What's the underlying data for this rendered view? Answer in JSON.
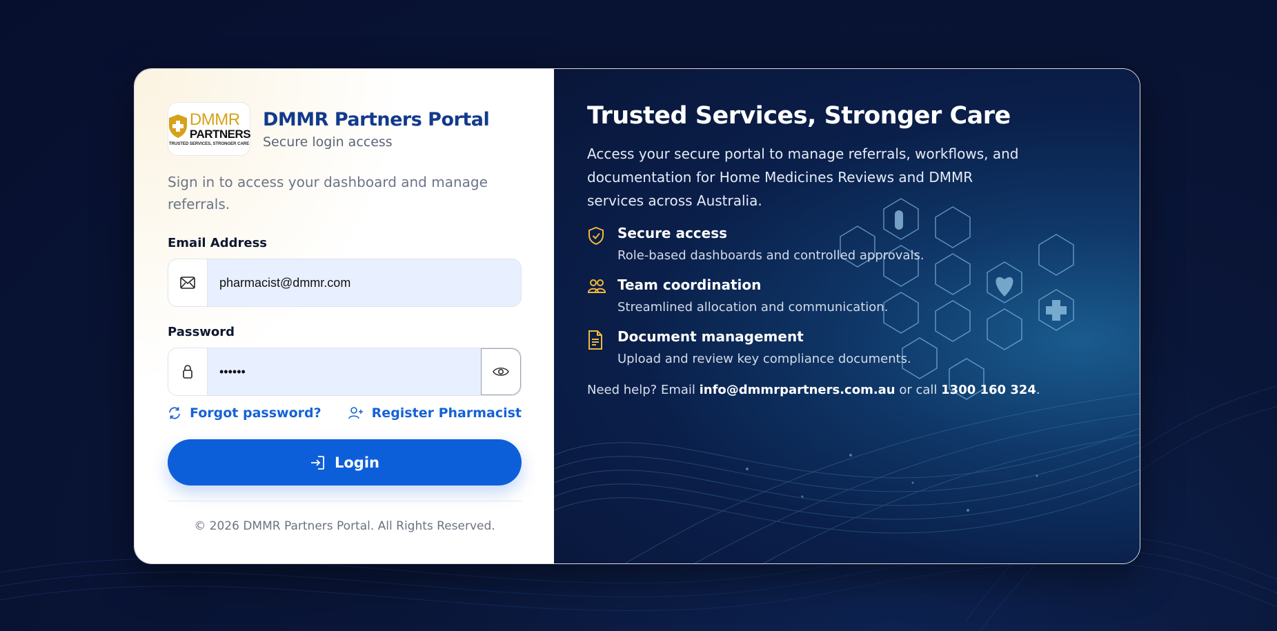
{
  "brand": {
    "logo_top": "DMMR",
    "logo_bottom": "PARTNERS",
    "logo_tagline": "TRUSTED SERVICES, STRONGER CARE",
    "title": "DMMR Partners Portal",
    "subtitle": "Secure login access"
  },
  "login": {
    "intro": "Sign in to access your dashboard and manage referrals.",
    "email_label": "Email Address",
    "email_value": "pharmacist@dmmr.com",
    "password_label": "Password",
    "password_value": "••••••",
    "forgot_label": "Forgot password?",
    "register_label": "Register Pharmacist",
    "login_label": "Login",
    "copyright": "© 2026 DMMR Partners Portal. All Rights Reserved."
  },
  "hero": {
    "title": "Trusted Services, Stronger Care",
    "description": "Access your secure portal to manage referrals, workflows, and documentation for Home Medicines Reviews and DMMR services across Australia.",
    "features": [
      {
        "icon": "shield-check-icon",
        "title": "Secure access",
        "desc": "Role-based dashboards and controlled approvals."
      },
      {
        "icon": "team-icon",
        "title": "Team coordination",
        "desc": "Streamlined allocation and communication."
      },
      {
        "icon": "document-icon",
        "title": "Document management",
        "desc": "Upload and review key compliance documents."
      }
    ],
    "help_prefix": "Need help? Email ",
    "help_email": "info@dmmrpartners.com.au",
    "help_middle": " or call ",
    "help_phone": "1300 160 324",
    "help_suffix": "."
  },
  "colors": {
    "accent": "#0d5fd9",
    "brand_title": "#123a8c",
    "icon_gold": "#f2b83a",
    "logo_gold": "#d6a21a"
  }
}
